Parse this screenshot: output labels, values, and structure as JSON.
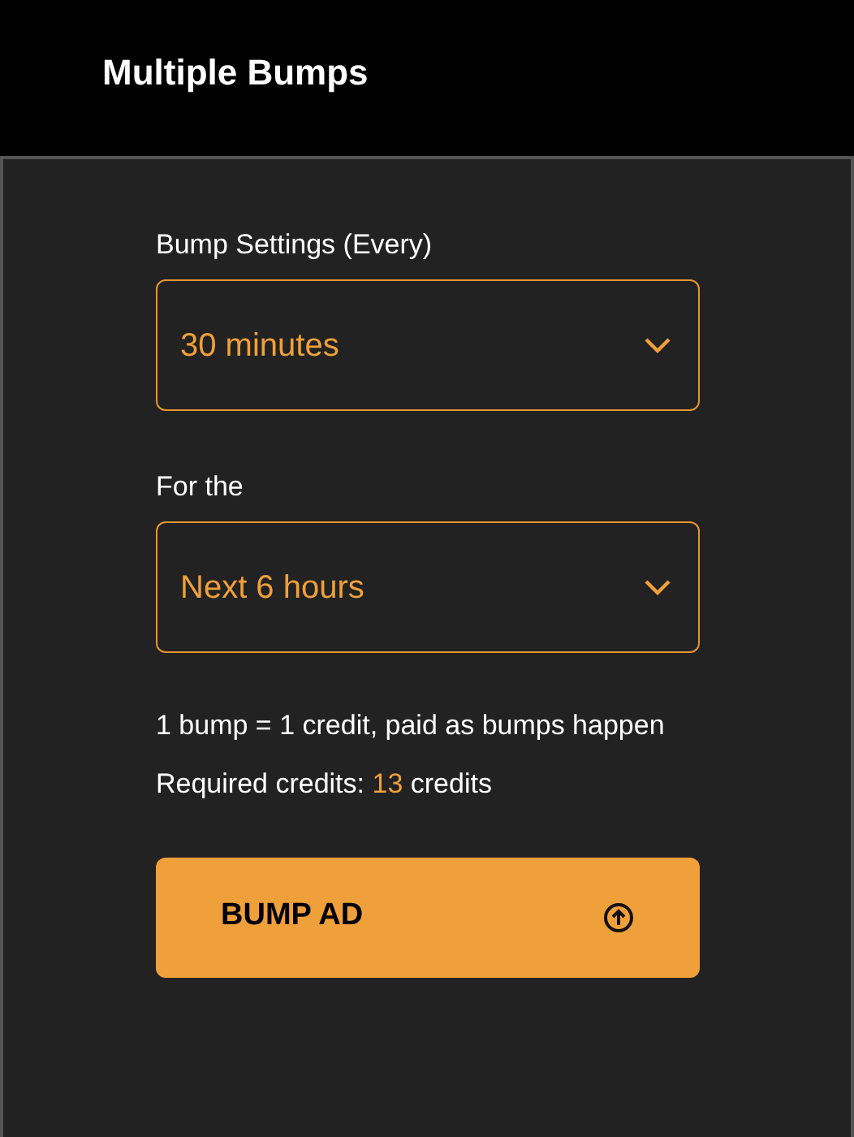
{
  "header": {
    "title": "Multiple Bumps"
  },
  "fields": [
    {
      "label": "Bump Settings (Every)",
      "value": "30 minutes"
    },
    {
      "label": "For the",
      "value": "Next 6 hours"
    }
  ],
  "note": "1 bump = 1 credit, paid as bumps happen",
  "required": {
    "label": "Required credits:",
    "value": "13",
    "unit": "credits"
  },
  "button": {
    "label": "BUMP AD"
  }
}
